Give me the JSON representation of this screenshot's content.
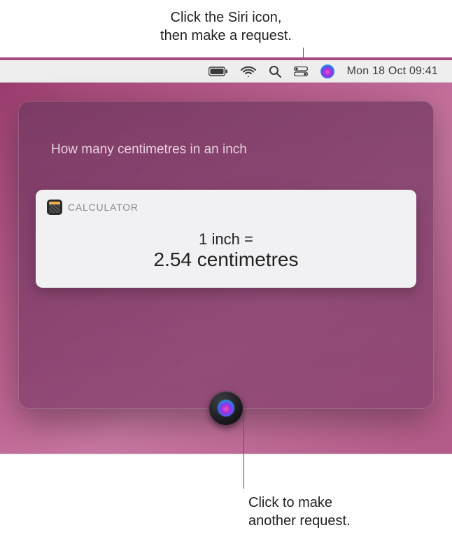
{
  "annotations": {
    "top_line1": "Click the Siri icon,",
    "top_line2": "then make a request.",
    "bottom_line1": "Click to make",
    "bottom_line2": "another request."
  },
  "menubar": {
    "datetime": "Mon 18 Oct  09:41"
  },
  "siri": {
    "query": "How many centimetres in an inch",
    "card": {
      "app_label": "CALCULATOR",
      "line1": "1 inch =",
      "line2": "2.54 centimetres"
    }
  }
}
